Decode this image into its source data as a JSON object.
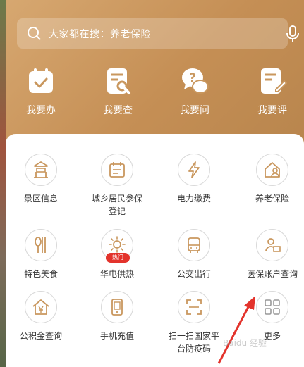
{
  "search": {
    "placeholder_text": "大家都在搜：养老保险",
    "icon": "search-icon",
    "voice_icon": "microphone-icon"
  },
  "quick_actions": [
    {
      "label": "我要办",
      "icon": "calendar-check-icon"
    },
    {
      "label": "我要查",
      "icon": "document-search-icon"
    },
    {
      "label": "我要问",
      "icon": "question-chat-icon"
    },
    {
      "label": "我要评",
      "icon": "document-edit-icon"
    }
  ],
  "services": [
    {
      "label": "景区信息",
      "icon": "pavilion-icon"
    },
    {
      "label": "城乡居民参保登记",
      "icon": "register-icon"
    },
    {
      "label": "电力缴费",
      "icon": "lightning-icon"
    },
    {
      "label": "养老保险",
      "icon": "house-person-icon"
    },
    {
      "label": "特色美食",
      "icon": "cutlery-icon"
    },
    {
      "label": "华电供热",
      "icon": "sun-icon",
      "badge": "热门"
    },
    {
      "label": "公交出行",
      "icon": "bus-icon"
    },
    {
      "label": "医保账户查询",
      "icon": "person-card-icon"
    },
    {
      "label": "公积金查询",
      "icon": "house-yen-icon"
    },
    {
      "label": "手机充值",
      "icon": "phone-icon"
    },
    {
      "label": "扫一扫国家平台防疫码",
      "icon": "scan-icon"
    },
    {
      "label": "更多",
      "icon": "grid-icon"
    }
  ],
  "colors": {
    "header": "#c9975e",
    "accent_red": "#e3332c",
    "arrow": "#e3332c"
  },
  "watermark": "Baidu 经验"
}
